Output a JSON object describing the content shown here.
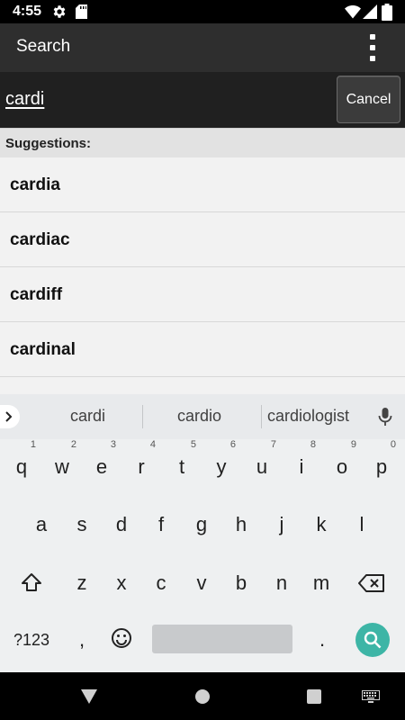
{
  "status_bar": {
    "time": "4:55",
    "icons": [
      "gear-icon",
      "sd-card-icon",
      "wifi-icon",
      "signal-icon",
      "battery-icon"
    ]
  },
  "action_bar": {
    "title": "Search",
    "overflow_icon": "overflow-menu-icon"
  },
  "search": {
    "query": "cardi",
    "cancel_label": "Cancel"
  },
  "suggestions": {
    "header": "Suggestions:",
    "items": [
      {
        "label": "cardia"
      },
      {
        "label": "cardiac"
      },
      {
        "label": "cardiff"
      },
      {
        "label": "cardinal"
      }
    ]
  },
  "keyboard": {
    "suggestion_strip": [
      "cardi",
      "cardio",
      "cardiologist"
    ],
    "row1": [
      {
        "key": "q",
        "hint": "1"
      },
      {
        "key": "w",
        "hint": "2"
      },
      {
        "key": "e",
        "hint": "3"
      },
      {
        "key": "r",
        "hint": "4"
      },
      {
        "key": "t",
        "hint": "5"
      },
      {
        "key": "y",
        "hint": "6"
      },
      {
        "key": "u",
        "hint": "7"
      },
      {
        "key": "i",
        "hint": "8"
      },
      {
        "key": "o",
        "hint": "9"
      },
      {
        "key": "p",
        "hint": "0"
      }
    ],
    "row2": [
      "a",
      "s",
      "d",
      "f",
      "g",
      "h",
      "j",
      "k",
      "l"
    ],
    "row3": [
      "z",
      "x",
      "c",
      "v",
      "b",
      "n",
      "m"
    ],
    "symbols_label": "?123",
    "comma": ",",
    "period": ".",
    "accent_color": "#3db5a6"
  },
  "nav_bar": {
    "icons": [
      "back-icon",
      "home-icon",
      "recents-icon",
      "keyboard-switch-icon"
    ]
  }
}
